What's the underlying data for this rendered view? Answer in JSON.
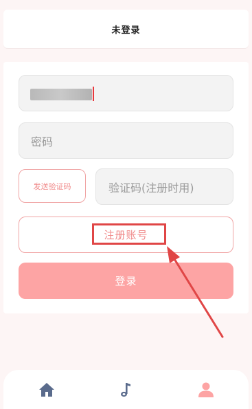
{
  "header": {
    "title": "未登录"
  },
  "form": {
    "username": {
      "value": ""
    },
    "password": {
      "placeholder": "密码"
    },
    "send_code_label": "发送验证码",
    "code": {
      "placeholder": "验证码(注册时用)"
    },
    "register_label": "注册账号",
    "login_label": "登录"
  },
  "tabs": [
    {
      "icon": "home-icon"
    },
    {
      "icon": "music-note-icon"
    },
    {
      "icon": "user-icon"
    }
  ],
  "colors": {
    "accent": "#fda4a4",
    "accent_text": "#f08a8a",
    "annotation": "#e04646",
    "icon": "#5a6b8c"
  }
}
